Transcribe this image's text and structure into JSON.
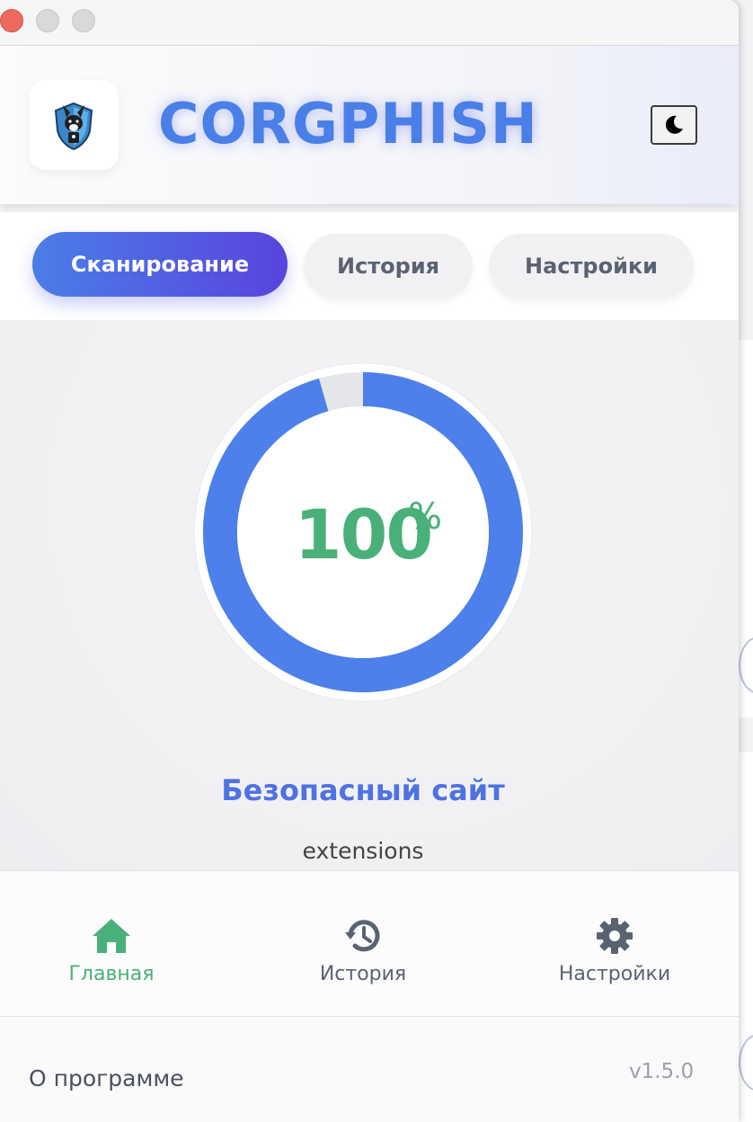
{
  "app": {
    "title": "CORGPHISH",
    "colors": {
      "accent": "#4a7fe8",
      "accent_end": "#5844dd",
      "safe": "#4ab079",
      "muted": "#5a6272"
    }
  },
  "header": {
    "logo_icon": "corgi-shield-logo-icon",
    "theme_toggle_icon": "moon-icon"
  },
  "tabs": [
    {
      "label": "Сканирование",
      "active": true
    },
    {
      "label": "История",
      "active": false
    },
    {
      "label": "Настройки",
      "active": false
    }
  ],
  "scan": {
    "score_value": 100,
    "score_number": "100",
    "score_unit": "%",
    "status": "Безопасный сайт",
    "domain": "extensions"
  },
  "bottom_nav": [
    {
      "label": "Главная",
      "icon": "home-icon",
      "active": true,
      "color": "#4ab079"
    },
    {
      "label": "История",
      "icon": "history-icon",
      "active": false,
      "color": "#5a6272"
    },
    {
      "label": "Настройки",
      "icon": "gear-icon",
      "active": false,
      "color": "#5a6272"
    }
  ],
  "footer": {
    "about": "О программе",
    "version": "v1.5.0"
  }
}
